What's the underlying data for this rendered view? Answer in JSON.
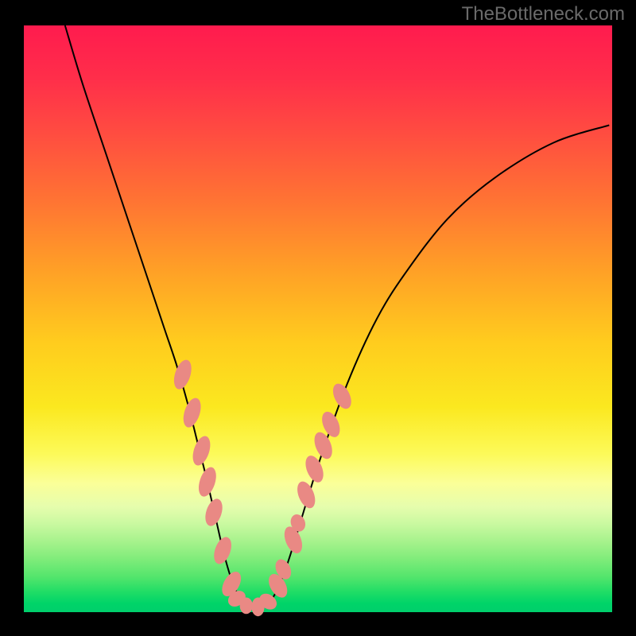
{
  "watermark": "TheBottleneck.com",
  "chart_data": {
    "type": "line",
    "title": "",
    "xlabel": "",
    "ylabel": "",
    "xlim": [
      0,
      100
    ],
    "ylim": [
      0,
      100
    ],
    "grid": false,
    "legend": false,
    "annotations": [],
    "series": [
      {
        "name": "curve",
        "color": "#000000",
        "x": [
          7.0,
          10,
          14,
          18,
          22,
          24,
          26,
          28,
          29.5,
          31,
          32.5,
          34,
          35.5,
          37,
          38.5,
          40,
          42,
          44,
          46,
          50,
          55,
          60,
          65,
          72,
          80,
          90,
          99.5
        ],
        "y": [
          100,
          90,
          78,
          66,
          54,
          48,
          42,
          35,
          29,
          23,
          16.5,
          10,
          5,
          2,
          1,
          1,
          2,
          6,
          12,
          25,
          39,
          50,
          58,
          67,
          74,
          80,
          83
        ]
      }
    ],
    "markers": {
      "name": "highlight-beads",
      "color": "#e98984",
      "points": [
        {
          "x": 27.0,
          "y": 40.5,
          "rx": 1.3,
          "ry": 2.6,
          "rot": 18
        },
        {
          "x": 28.6,
          "y": 34.0,
          "rx": 1.3,
          "ry": 2.6,
          "rot": 18
        },
        {
          "x": 30.2,
          "y": 27.5,
          "rx": 1.3,
          "ry": 2.6,
          "rot": 18
        },
        {
          "x": 31.2,
          "y": 22.2,
          "rx": 1.3,
          "ry": 2.6,
          "rot": 18
        },
        {
          "x": 32.3,
          "y": 17.0,
          "rx": 1.3,
          "ry": 2.4,
          "rot": 18
        },
        {
          "x": 33.8,
          "y": 10.5,
          "rx": 1.3,
          "ry": 2.4,
          "rot": 20
        },
        {
          "x": 35.3,
          "y": 4.8,
          "rx": 1.3,
          "ry": 2.3,
          "rot": 30
        },
        {
          "x": 36.2,
          "y": 2.3,
          "rx": 1.2,
          "ry": 1.6,
          "rot": 55
        },
        {
          "x": 37.8,
          "y": 1.1,
          "rx": 1.4,
          "ry": 1.1,
          "rot": 90
        },
        {
          "x": 39.8,
          "y": 0.9,
          "rx": 1.6,
          "ry": 1.1,
          "rot": 90
        },
        {
          "x": 41.5,
          "y": 1.8,
          "rx": 1.2,
          "ry": 1.6,
          "rot": -55
        },
        {
          "x": 43.2,
          "y": 4.5,
          "rx": 1.3,
          "ry": 2.2,
          "rot": -30
        },
        {
          "x": 44.1,
          "y": 7.3,
          "rx": 1.2,
          "ry": 1.8,
          "rot": -25
        },
        {
          "x": 45.8,
          "y": 12.3,
          "rx": 1.3,
          "ry": 2.4,
          "rot": -22
        },
        {
          "x": 46.6,
          "y": 15.2,
          "rx": 1.2,
          "ry": 1.5,
          "rot": -22
        },
        {
          "x": 48.0,
          "y": 20.0,
          "rx": 1.3,
          "ry": 2.4,
          "rot": -22
        },
        {
          "x": 49.4,
          "y": 24.4,
          "rx": 1.3,
          "ry": 2.4,
          "rot": -22
        },
        {
          "x": 50.9,
          "y": 28.4,
          "rx": 1.3,
          "ry": 2.4,
          "rot": -22
        },
        {
          "x": 52.2,
          "y": 32.0,
          "rx": 1.3,
          "ry": 2.3,
          "rot": -24
        },
        {
          "x": 54.1,
          "y": 36.8,
          "rx": 1.3,
          "ry": 2.3,
          "rot": -26
        }
      ]
    },
    "background_gradient": {
      "direction": "vertical",
      "stops": [
        {
          "pos": 0.0,
          "color": "#ff1b4e"
        },
        {
          "pos": 0.09,
          "color": "#ff2e4a"
        },
        {
          "pos": 0.18,
          "color": "#ff4b41"
        },
        {
          "pos": 0.3,
          "color": "#ff7433"
        },
        {
          "pos": 0.42,
          "color": "#ffa126"
        },
        {
          "pos": 0.54,
          "color": "#ffcc1e"
        },
        {
          "pos": 0.65,
          "color": "#fbe81f"
        },
        {
          "pos": 0.73,
          "color": "#fcfa59"
        },
        {
          "pos": 0.78,
          "color": "#fbff98"
        },
        {
          "pos": 0.82,
          "color": "#e6fdad"
        },
        {
          "pos": 0.85,
          "color": "#c9f9a0"
        },
        {
          "pos": 0.88,
          "color": "#a6f28c"
        },
        {
          "pos": 0.91,
          "color": "#7fec7a"
        },
        {
          "pos": 0.94,
          "color": "#53e56c"
        },
        {
          "pos": 0.965,
          "color": "#21dd66"
        },
        {
          "pos": 0.985,
          "color": "#00d468"
        },
        {
          "pos": 1.0,
          "color": "#00cf6c"
        }
      ]
    }
  }
}
